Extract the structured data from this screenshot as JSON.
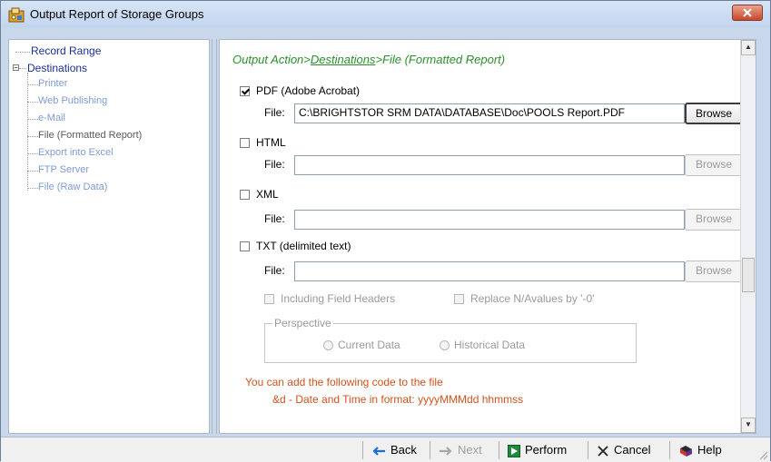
{
  "window": {
    "title": "Output Report of Storage Groups"
  },
  "tree": {
    "top_items": [
      {
        "label": "Record Range"
      },
      {
        "label": "Destinations",
        "expanded": true
      }
    ],
    "destinations": [
      {
        "label": "Printer",
        "state": "enabled"
      },
      {
        "label": "Web Publishing",
        "state": "enabled"
      },
      {
        "label": "e-Mail",
        "state": "enabled"
      },
      {
        "label": "File (Formatted Report)",
        "state": "selected"
      },
      {
        "label": "Export into Excel",
        "state": "enabled"
      },
      {
        "label": "FTP Server",
        "state": "enabled"
      },
      {
        "label": "File (Raw Data)",
        "state": "enabled"
      }
    ]
  },
  "breadcrumb": {
    "prefix": "Output Action>",
    "link": "Destinations",
    "suffix": ">File (Formatted Report)"
  },
  "formats": [
    {
      "label": "PDF (Adobe Acrobat)",
      "checked": true,
      "file_label": "File:",
      "file_value": "C:\\BRIGHTSTOR SRM DATA\\DATABASE\\Doc\\POOLS Report.PDF",
      "browse": "Browse",
      "enabled": true
    },
    {
      "label": "HTML",
      "checked": false,
      "file_label": "File:",
      "file_value": "",
      "browse": "Browse",
      "enabled": false
    },
    {
      "label": "XML",
      "checked": false,
      "file_label": "File:",
      "file_value": "",
      "browse": "Browse",
      "enabled": false
    },
    {
      "label": "TXT (delimited text)",
      "checked": false,
      "file_label": "File:",
      "file_value": "",
      "browse": "Browse",
      "enabled": false
    }
  ],
  "txt_options": {
    "include_headers": "Including Field Headers",
    "replace_na": "Replace N/Avalues by '-0'"
  },
  "perspective": {
    "legend": "Perspective",
    "current": "Current Data",
    "historical": "Historical Data"
  },
  "note": {
    "line1": "You can add the following code to the file",
    "line2": "&d - Date and Time in format: yyyyMMMdd hhmmss"
  },
  "footer": {
    "back": "Back",
    "next": "Next",
    "perform": "Perform",
    "cancel": "Cancel",
    "help": "Help"
  },
  "colors": {
    "breadcrumb": "#2a8f2a",
    "note": "#d2521f",
    "tree_link": "#1a2e9c",
    "tree_child": "#7e9bd6"
  }
}
